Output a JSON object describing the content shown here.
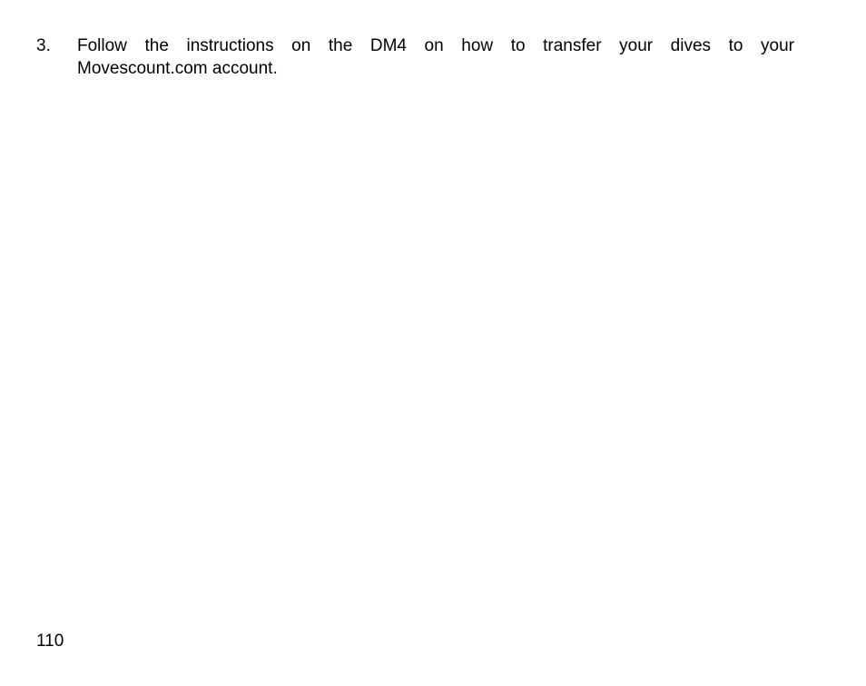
{
  "steps": [
    {
      "number": "3.",
      "line1": "Follow the instructions on the DM4 on how to transfer your dives to your",
      "line2": "Movescount.com account."
    }
  ],
  "footer": {
    "page_number": "110"
  }
}
